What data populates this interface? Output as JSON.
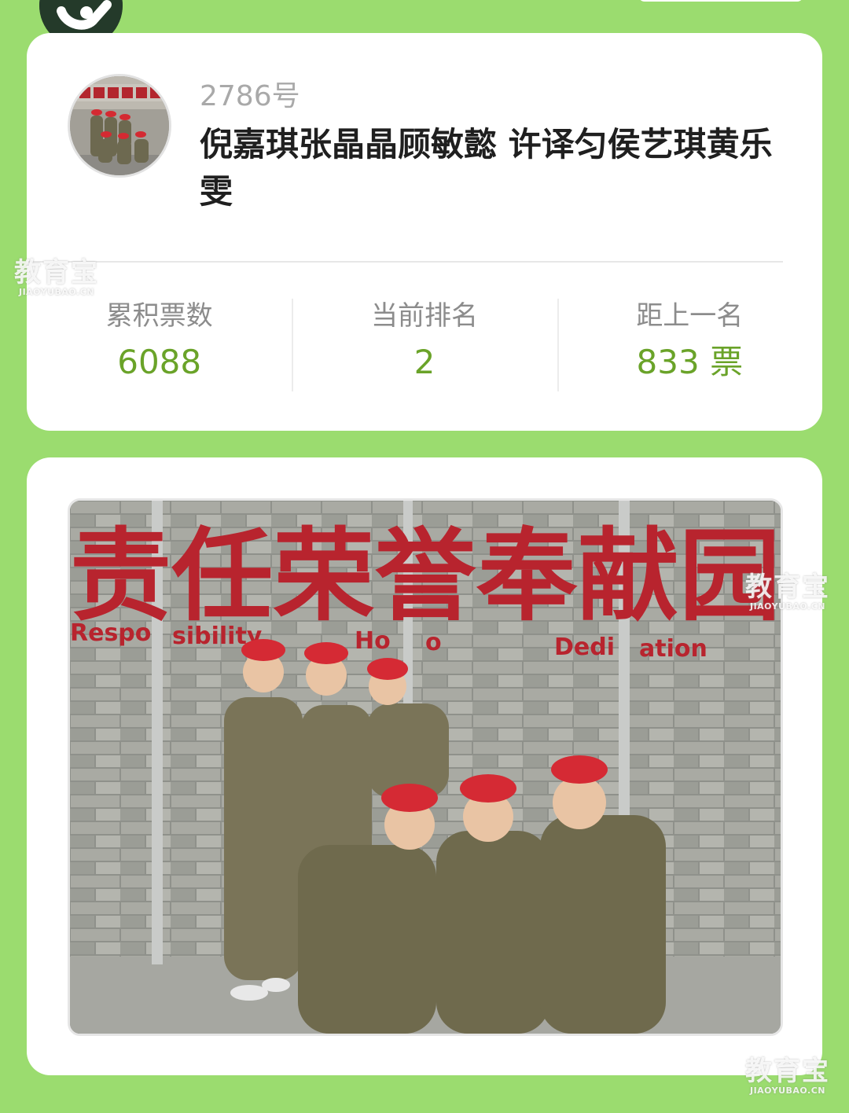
{
  "entry": {
    "number": "2786号",
    "title": "倪嘉琪张晶晶顾敏懿 许译匀侯艺琪黄乐雯"
  },
  "stats": [
    {
      "label": "累积票数",
      "value": "6088"
    },
    {
      "label": "当前排名",
      "value": "2"
    },
    {
      "label": "距上一名",
      "value": "833 票"
    }
  ],
  "photo": {
    "sign_text": "责任荣誉奉献园",
    "sign_subtext": [
      "Respo",
      "sibility",
      "Ho",
      "o",
      "Dedi",
      "ation"
    ]
  },
  "watermark": {
    "main": "教育宝",
    "sub": "JIAOYUBAO.CN"
  },
  "colors": {
    "background": "#9bdc6f",
    "card": "#ffffff",
    "stat_value": "#6aa329",
    "sign_red": "#b8242e"
  }
}
